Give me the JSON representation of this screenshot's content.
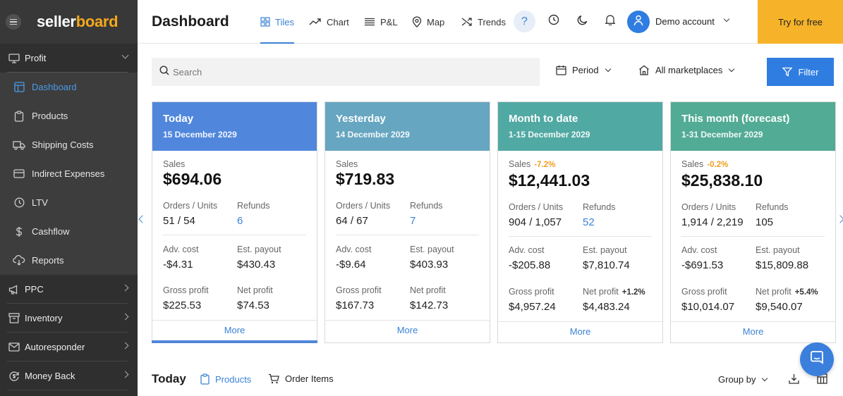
{
  "brand": {
    "name_part1": "seller",
    "name_part2": "board"
  },
  "sidebar": {
    "sections": [
      {
        "label": "Profit",
        "icon": "monitor-icon",
        "expanded": true
      },
      {
        "label": "PPC",
        "icon": "megaphone-icon"
      },
      {
        "label": "Inventory",
        "icon": "archive-icon"
      },
      {
        "label": "Autoresponder",
        "icon": "mail-icon"
      },
      {
        "label": "Money Back",
        "icon": "refresh-dollar-icon"
      }
    ],
    "profit_items": [
      {
        "label": "Dashboard",
        "icon": "layout-icon",
        "active": true
      },
      {
        "label": "Products",
        "icon": "clipboard-icon"
      },
      {
        "label": "Shipping Costs",
        "icon": "truck-icon"
      },
      {
        "label": "Indirect Expenses",
        "icon": "card-icon"
      },
      {
        "label": "LTV",
        "icon": "clock-icon"
      },
      {
        "label": "Cashflow",
        "icon": "dollar-icon"
      },
      {
        "label": "Reports",
        "icon": "cloud-download-icon"
      }
    ]
  },
  "header": {
    "title": "Dashboard",
    "tabs": [
      {
        "label": "Tiles",
        "icon": "grid-icon",
        "active": true
      },
      {
        "label": "Chart",
        "icon": "line-chart-icon"
      },
      {
        "label": "P&L",
        "icon": "list-icon"
      },
      {
        "label": "Map",
        "icon": "map-pin-icon"
      },
      {
        "label": "Trends",
        "icon": "shuffle-icon"
      }
    ],
    "help": "?",
    "account": "Demo account",
    "cta": "Try for free"
  },
  "filters": {
    "search_placeholder": "Search",
    "period": "Period",
    "marketplaces": "All marketplaces",
    "filter_button": "Filter"
  },
  "colors": {
    "accent": "#2f7de1",
    "cta": "#f6b32a",
    "card_today": "#5087dd",
    "card_yesterday": "#66a6c1",
    "card_month": "#51a9a3",
    "card_forecast": "#52ab95"
  },
  "cards": [
    {
      "title": "Today",
      "date": "15 December 2029",
      "sales_label": "Sales",
      "sales_change": "",
      "sales": "$694.06",
      "orders_label": "Orders / Units",
      "orders": "51 / 54",
      "refunds_label": "Refunds",
      "refunds": "6",
      "refunds_link": true,
      "adv_label": "Adv. cost",
      "adv": "-$4.31",
      "payout_label": "Est. payout",
      "payout": "$430.43",
      "gross_label": "Gross profit",
      "gross": "$225.53",
      "net_label": "Net profit",
      "net_change": "",
      "net": "$74.53",
      "more": "More"
    },
    {
      "title": "Yesterday",
      "date": "14 December 2029",
      "sales_label": "Sales",
      "sales_change": "",
      "sales": "$719.83",
      "orders_label": "Orders / Units",
      "orders": "64 / 67",
      "refunds_label": "Refunds",
      "refunds": "7",
      "refunds_link": true,
      "adv_label": "Adv. cost",
      "adv": "-$9.64",
      "payout_label": "Est. payout",
      "payout": "$403.93",
      "gross_label": "Gross profit",
      "gross": "$167.73",
      "net_label": "Net profit",
      "net_change": "",
      "net": "$142.73",
      "more": "More"
    },
    {
      "title": "Month to date",
      "date": "1-15 December 2029",
      "sales_label": "Sales",
      "sales_change": "-7.2%",
      "sales": "$12,441.03",
      "orders_label": "Orders / Units",
      "orders": "904 / 1,057",
      "refunds_label": "Refunds",
      "refunds": "52",
      "refunds_link": true,
      "adv_label": "Adv. cost",
      "adv": "-$205.88",
      "payout_label": "Est. payout",
      "payout": "$7,810.74",
      "gross_label": "Gross profit",
      "gross": "$4,957.24",
      "net_label": "Net profit",
      "net_change": "+1.2%",
      "net": "$4,483.24",
      "more": "More"
    },
    {
      "title": "This month (forecast)",
      "date": "1-31 December 2029",
      "sales_label": "Sales",
      "sales_change": "-0.2%",
      "sales": "$25,838.10",
      "orders_label": "Orders / Units",
      "orders": "1,914 / 2,219",
      "refunds_label": "Refunds",
      "refunds": "105",
      "refunds_link": false,
      "adv_label": "Adv. cost",
      "adv": "-$691.53",
      "payout_label": "Est. payout",
      "payout": "$15,809.88",
      "gross_label": "Gross profit",
      "gross": "$10,014.07",
      "net_label": "Net profit",
      "net_change": "+5.4%",
      "net": "$9,540.07",
      "more": "More"
    }
  ],
  "bottom": {
    "title": "Today",
    "tabs": [
      {
        "label": "Products",
        "icon": "clipboard-icon",
        "active": true
      },
      {
        "label": "Order Items",
        "icon": "cart-icon"
      }
    ],
    "group_by": "Group by"
  }
}
